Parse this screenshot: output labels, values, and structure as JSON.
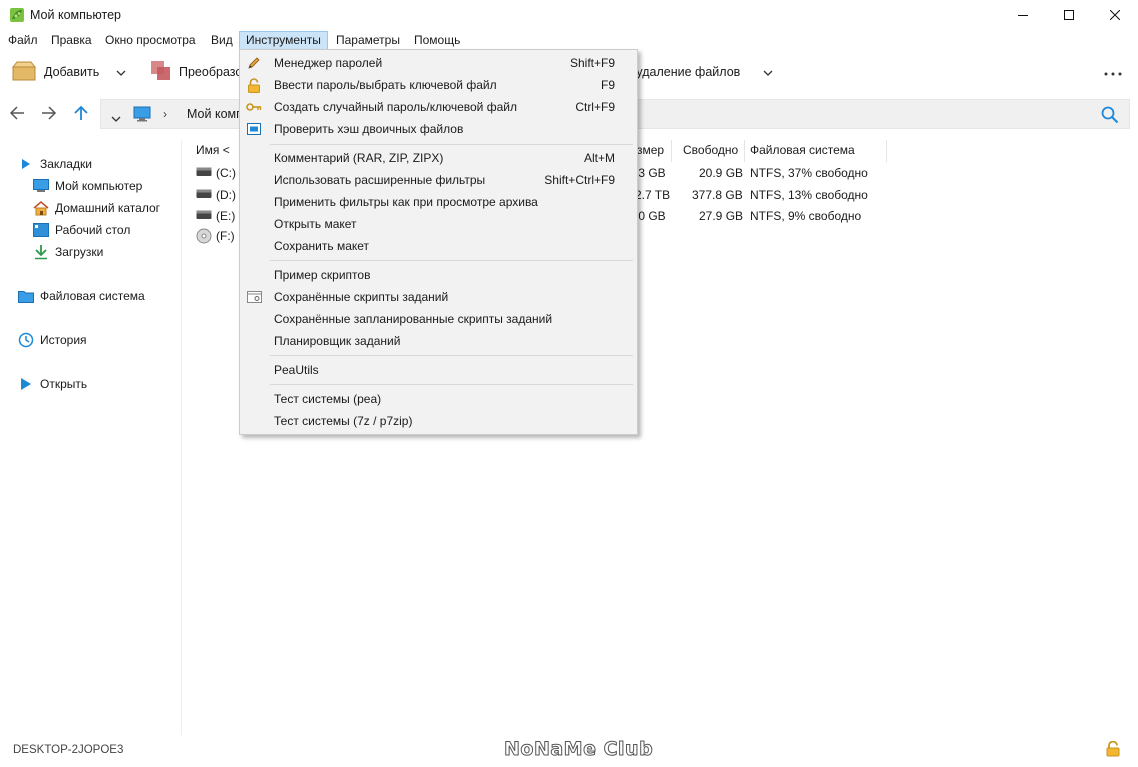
{
  "window": {
    "title": "Мой компьютер",
    "icon": "peazip-app-icon",
    "controls": [
      "minimize-icon",
      "maximize-icon",
      "close-icon"
    ]
  },
  "menubar": {
    "items": [
      "Файл",
      "Правка",
      "Окно просмотра",
      "Вид",
      "Инструменты",
      "Параметры",
      "Помощь"
    ],
    "active": "Инструменты"
  },
  "toolbar": {
    "add_label": "Добавить",
    "convert_label": "Преобразо",
    "delete_label": "е удаление файлов"
  },
  "address": {
    "path": "Мой компь",
    "search_icon": "search-icon"
  },
  "sidebar": {
    "bookmarks_label": "Закладки",
    "bookmarks": [
      "Мой компьютер",
      "Домашний каталог",
      "Рабочий стол",
      "Загрузки"
    ],
    "filesystem_label": "Файловая система",
    "history_label": "История",
    "open_label": "Открыть"
  },
  "table": {
    "headers": {
      "name": "Имя <",
      "size": "змер",
      "free": "Свободно",
      "fs": "Файловая система"
    },
    "rows": [
      {
        "name": "(C:) ",
        "size": ".3 GB",
        "free": "20.9 GB",
        "fs": "NTFS, 37% свободно"
      },
      {
        "name": "(D:) ",
        "size": "2.7 TB",
        "free": "377.8 GB",
        "fs": "NTFS, 13% свободно"
      },
      {
        "name": "(E:) F",
        "size": ".0 GB",
        "free": "27.9 GB",
        "fs": "NTFS, 9% свободно"
      },
      {
        "name": "(F:) ",
        "size": "",
        "free": "",
        "fs": ""
      }
    ]
  },
  "tools_menu": {
    "items": [
      {
        "label": "Менеджер паролей",
        "shortcut": "Shift+F9",
        "icon": "pencil-icon"
      },
      {
        "label": "Ввести пароль/выбрать ключевой файл",
        "shortcut": "F9",
        "icon": "padlock-icon"
      },
      {
        "label": "Создать случайный пароль/ключевой файл",
        "shortcut": "Ctrl+F9",
        "icon": "key-icon"
      },
      {
        "label": "Проверить хэш двоичных файлов",
        "shortcut": "",
        "icon": "hash-window-icon"
      },
      {
        "label": "Комментарий (RAR, ZIP, ZIPX)",
        "shortcut": "Alt+M",
        "icon": ""
      },
      {
        "label": "Использовать расширенные фильтры",
        "shortcut": "Shift+Ctrl+F9",
        "icon": ""
      },
      {
        "label": "Применить фильтры как при просмотре архива",
        "shortcut": "",
        "icon": ""
      },
      {
        "label": "Открыть макет",
        "shortcut": "",
        "icon": ""
      },
      {
        "label": "Сохранить макет",
        "shortcut": "",
        "icon": ""
      },
      {
        "label": "Пример скриптов",
        "shortcut": "",
        "icon": ""
      },
      {
        "label": "Сохранённые скрипты заданий",
        "shortcut": "",
        "icon": "script-window-icon"
      },
      {
        "label": "Сохранённые запланированные скрипты заданий",
        "shortcut": "",
        "icon": ""
      },
      {
        "label": "Планировщик заданий",
        "shortcut": "",
        "icon": ""
      },
      {
        "label": "PeaUtils",
        "shortcut": "",
        "icon": ""
      },
      {
        "label": "Тест системы (pea)",
        "shortcut": "",
        "icon": ""
      },
      {
        "label": "Тест системы (7z / p7zip)",
        "shortcut": "",
        "icon": ""
      }
    ]
  },
  "status": {
    "computer_name": "DESKTOP-2JOPOE3",
    "watermark": "NoNaMe Club",
    "lock_icon": "padlock-icon"
  }
}
